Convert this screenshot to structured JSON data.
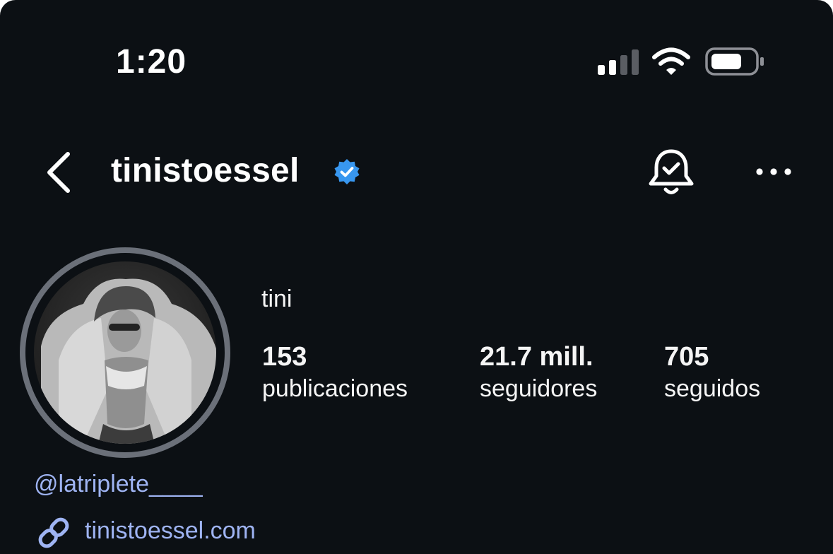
{
  "status_bar": {
    "time": "1:20",
    "signal_icon": "cellular-signal-icon",
    "wifi_icon": "wifi-icon",
    "battery_icon": "battery-icon"
  },
  "header": {
    "back_icon": "chevron-left-icon",
    "username": "tinistoessel",
    "verified_icon": "verified-badge-icon",
    "notifications_icon": "bell-check-icon",
    "more_icon": "more-horizontal-icon"
  },
  "profile": {
    "avatar_icon": "profile-avatar",
    "display_name": "tini",
    "stats": [
      {
        "value": "153",
        "label": "publicaciones"
      },
      {
        "value": "21.7 mill.",
        "label": "seguidores"
      },
      {
        "value": "705",
        "label": "seguidos"
      }
    ],
    "mention": "@latriplete____",
    "link_icon": "link-icon",
    "website": "tinistoessel.com"
  },
  "colors": {
    "background": "#0c1014",
    "text": "#f5f5f5",
    "link": "#9fb4f3",
    "verified": "#3897f0",
    "story_ring": "#6b7079"
  }
}
